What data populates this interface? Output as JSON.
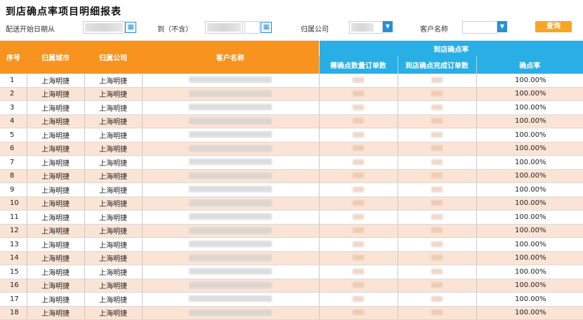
{
  "title": "到店确点率项目明细报表",
  "filters": {
    "date_label": "配送开始日期从",
    "to_label": "到（不含）",
    "company_label": "归属公司",
    "store_label": "客户名称",
    "query_button": "查询",
    "calendar_icon": "calendar-icon",
    "dropdown_icon": "chevron-down-icon"
  },
  "table": {
    "headers": {
      "index": "序号",
      "branch": "归属城市",
      "company": "归属公司",
      "customer": "客户名称",
      "group": "到店确点率",
      "sub1": "需确点数量订单数",
      "sub2": "到店确点完成订单数",
      "sub3": "确点率"
    },
    "rows": [
      {
        "idx": "1",
        "branch": "上海明捷",
        "company": "上海明捷",
        "rate": "100.00%"
      },
      {
        "idx": "2",
        "branch": "上海明捷",
        "company": "上海明捷",
        "rate": "100.00%"
      },
      {
        "idx": "3",
        "branch": "上海明捷",
        "company": "上海明捷",
        "rate": "100.00%"
      },
      {
        "idx": "4",
        "branch": "上海明捷",
        "company": "上海明捷",
        "rate": "100.00%"
      },
      {
        "idx": "5",
        "branch": "上海明捷",
        "company": "上海明捷",
        "rate": "100.00%"
      },
      {
        "idx": "6",
        "branch": "上海明捷",
        "company": "上海明捷",
        "rate": "100.00%"
      },
      {
        "idx": "7",
        "branch": "上海明捷",
        "company": "上海明捷",
        "rate": "100.00%"
      },
      {
        "idx": "8",
        "branch": "上海明捷",
        "company": "上海明捷",
        "rate": "100.00%"
      },
      {
        "idx": "9",
        "branch": "上海明捷",
        "company": "上海明捷",
        "rate": "100.00%"
      },
      {
        "idx": "10",
        "branch": "上海明捷",
        "company": "上海明捷",
        "rate": "100.00%"
      },
      {
        "idx": "11",
        "branch": "上海明捷",
        "company": "上海明捷",
        "rate": "100.00%"
      },
      {
        "idx": "12",
        "branch": "上海明捷",
        "company": "上海明捷",
        "rate": "100.00%"
      },
      {
        "idx": "13",
        "branch": "上海明捷",
        "company": "上海明捷",
        "rate": "100.00%"
      },
      {
        "idx": "14",
        "branch": "上海明捷",
        "company": "上海明捷",
        "rate": "100.00%"
      },
      {
        "idx": "15",
        "branch": "上海明捷",
        "company": "上海明捷",
        "rate": "100.00%"
      },
      {
        "idx": "16",
        "branch": "上海明捷",
        "company": "上海明捷",
        "rate": "100.00%"
      },
      {
        "idx": "17",
        "branch": "上海明捷",
        "company": "上海明捷",
        "rate": "100.00%"
      },
      {
        "idx": "18",
        "branch": "上海明捷",
        "company": "上海明捷",
        "rate": "100.00%"
      }
    ]
  },
  "colors": {
    "header_orange": "#f7931e",
    "header_blue": "#29aee6",
    "row_even": "#fbe4d5",
    "accent_blue": "#2a8fd6",
    "query_orange": "#f5a623"
  }
}
